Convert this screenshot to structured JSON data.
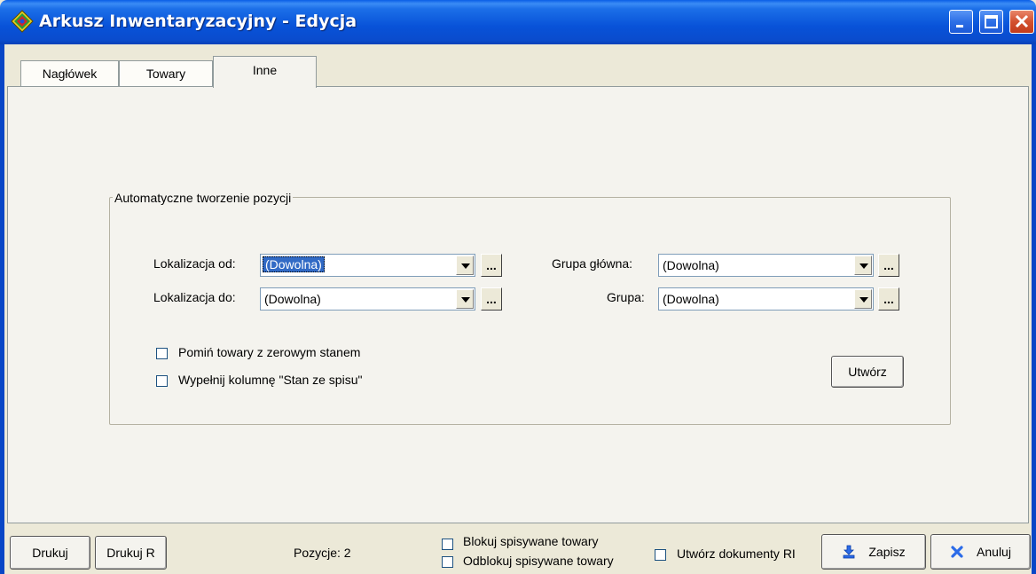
{
  "window": {
    "title": "Arkusz Inwentaryzacyjny - Edycja",
    "accent": "#0a5ee6"
  },
  "tabs": [
    {
      "label": "Nagłówek",
      "active": false
    },
    {
      "label": "Towary",
      "active": false
    },
    {
      "label": "Inne",
      "active": true
    }
  ],
  "group": {
    "title": "Automatyczne tworzenie pozycji",
    "lokalizacja_od": {
      "label": "Lokalizacja od:",
      "value": "(Dowolna)"
    },
    "lokalizacja_do": {
      "label": "Lokalizacja do:",
      "value": "(Dowolna)"
    },
    "grupa_glowna": {
      "label": "Grupa główna:",
      "value": "(Dowolna)"
    },
    "grupa": {
      "label": "Grupa:",
      "value": "(Dowolna)"
    },
    "dots_label": "...",
    "pomin": {
      "label": "Pomiń towary z zerowym stanem",
      "checked": false
    },
    "wypelnij": {
      "label": "Wypełnij kolumnę \"Stan ze spisu\"",
      "checked": false
    },
    "utworz_label": "Utwórz"
  },
  "footer": {
    "drukuj_label": "Drukuj",
    "drukuj_r_label": "Drukuj R",
    "pozycje_text": "Pozycje: 2",
    "blokuj": {
      "label": "Blokuj spisywane towary",
      "checked": false
    },
    "odblokuj": {
      "label": "Odblokuj spisywane towary",
      "checked": false
    },
    "utworz_ri": {
      "label": "Utwórz dokumenty RI",
      "checked": false
    },
    "zapisz_label": "Zapisz",
    "anuluj_label": "Anuluj"
  }
}
